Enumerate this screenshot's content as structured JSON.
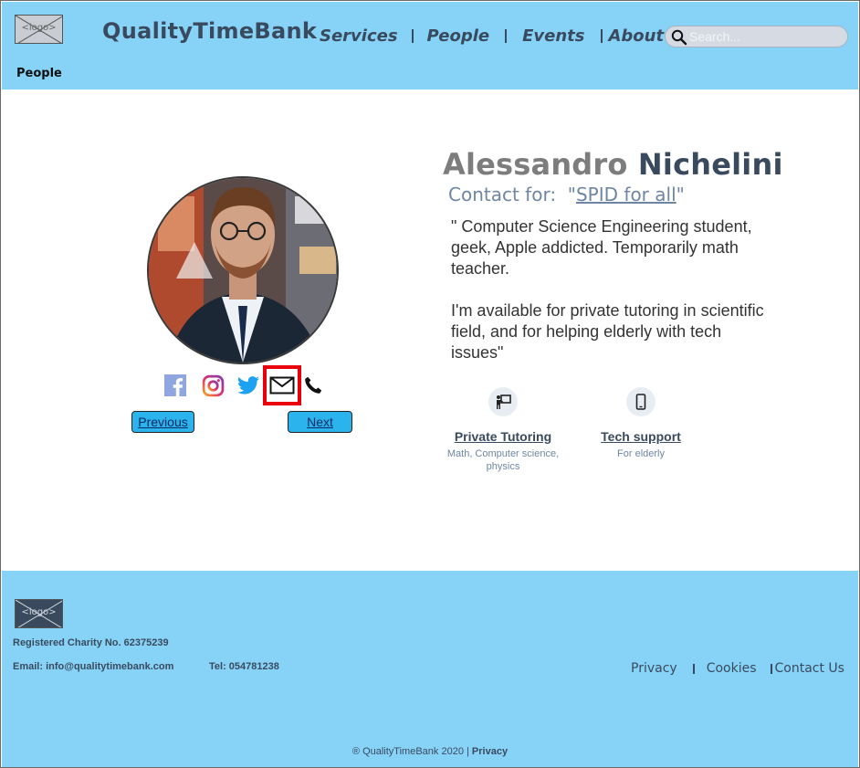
{
  "header": {
    "logo_alt": "<logo>",
    "brand": "QualityTimeBank",
    "nav": [
      "Services",
      "People",
      "Events",
      "About Us"
    ],
    "search_placeholder": "Search...",
    "breadcrumb": "People"
  },
  "profile": {
    "first_name": "Alessandro",
    "last_name": "Nichelini",
    "contact_prefix": "Contact for:",
    "contact_open_quote": "\"",
    "contact_link": "SPID for all",
    "contact_close_quote": "\"",
    "bio": "\" Computer Science Engineering student, geek, Apple addicted. Temporarily math teacher.\n\nI'm available for private tutoring in scientific field, and for helping elderly with tech issues\"",
    "socials": [
      "facebook-icon",
      "instagram-icon",
      "twitter-icon",
      "mail-icon",
      "phone-icon"
    ],
    "previous_label": "Previous",
    "next_label": "Next",
    "services": [
      {
        "title": "Private Tutoring",
        "subtitle": "Math, Computer science, physics",
        "icon": "teacher-board-icon"
      },
      {
        "title": "Tech support",
        "subtitle": "For elderly",
        "icon": "smartphone-icon"
      }
    ]
  },
  "footer": {
    "logo_alt": "<logo>",
    "charity": "Registered Charity No. 62375239",
    "email": "Email:  info@qualitytimebank.com",
    "tel": "Tel: 054781238",
    "links": [
      "Privacy",
      "Cookies",
      "Contact Us"
    ],
    "copyright": "® QualityTimeBank 2020 | ",
    "copyright_link": "Privacy"
  },
  "colors": {
    "header_bg": "#87d3f8",
    "brand_text": "#3a4a5e",
    "button_bg": "#2bb3ee",
    "highlight_box": "#e8000a"
  }
}
